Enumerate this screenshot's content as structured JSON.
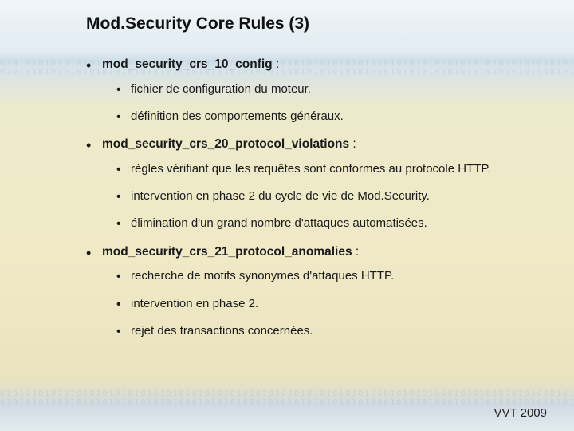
{
  "title": "Mod.Security Core Rules (3)",
  "bullets": [
    {
      "label": "mod_security_crs_10_config",
      "suffix": " :",
      "sub": [
        "fichier de configuration du moteur.",
        "définition des comportements généraux."
      ]
    },
    {
      "label": "mod_security_crs_20_protocol_violations",
      "suffix": " :",
      "sub": [
        "règles vérifiant que les requêtes sont conformes au protocole HTTP.",
        "intervention en phase 2 du cycle de vie de Mod.Security.",
        "élimination d'un grand nombre d'attaques automatisées."
      ]
    },
    {
      "label": "mod_security_crs_21_protocol_anomalies",
      "suffix": " :",
      "sub": [
        "recherche de motifs synonymes d'attaques HTTP.",
        "intervention en phase 2.",
        "rejet des transactions concernées."
      ]
    }
  ],
  "footer": "VVT 2009",
  "decor_binary": "010101010101010101010101010101010101010101010101010101010101010101010101010101010101010101"
}
